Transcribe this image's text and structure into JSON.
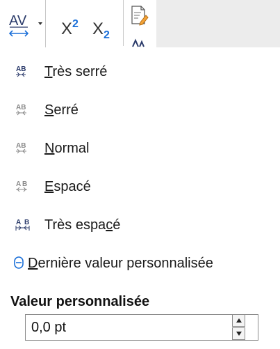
{
  "toolbar": {
    "spacing_button_glyph": "AV",
    "superscript_base": "X",
    "superscript_mark": "2",
    "subscript_base": "X",
    "subscript_mark": "2",
    "icons": [
      "character-spacing-icon",
      "superscript-icon",
      "subscript-icon",
      "edit-document-icon"
    ]
  },
  "menu": {
    "items": [
      {
        "pre": "",
        "mnemonic": "T",
        "post": "rès serré",
        "icon": "spacing-very-tight-icon"
      },
      {
        "pre": "",
        "mnemonic": "S",
        "post": "erré",
        "icon": "spacing-tight-icon"
      },
      {
        "pre": "",
        "mnemonic": "N",
        "post": "ormal",
        "icon": "spacing-normal-icon"
      },
      {
        "pre": "",
        "mnemonic": "E",
        "post": "spacé",
        "icon": "spacing-loose-icon"
      },
      {
        "pre": "Très espa",
        "mnemonic": "c",
        "post": "é",
        "icon": "spacing-very-loose-icon"
      },
      {
        "pre": "",
        "mnemonic": "D",
        "post": "ernière valeur personnalisée",
        "icon": "custom-value-icon"
      }
    ]
  },
  "custom": {
    "heading": "Valeur personnalisée",
    "value": "0,0 pt"
  },
  "colors": {
    "accent": "#1a6fd8",
    "icon_gray": "#7f7f7f",
    "icon_dark": "#2a3a6a"
  }
}
